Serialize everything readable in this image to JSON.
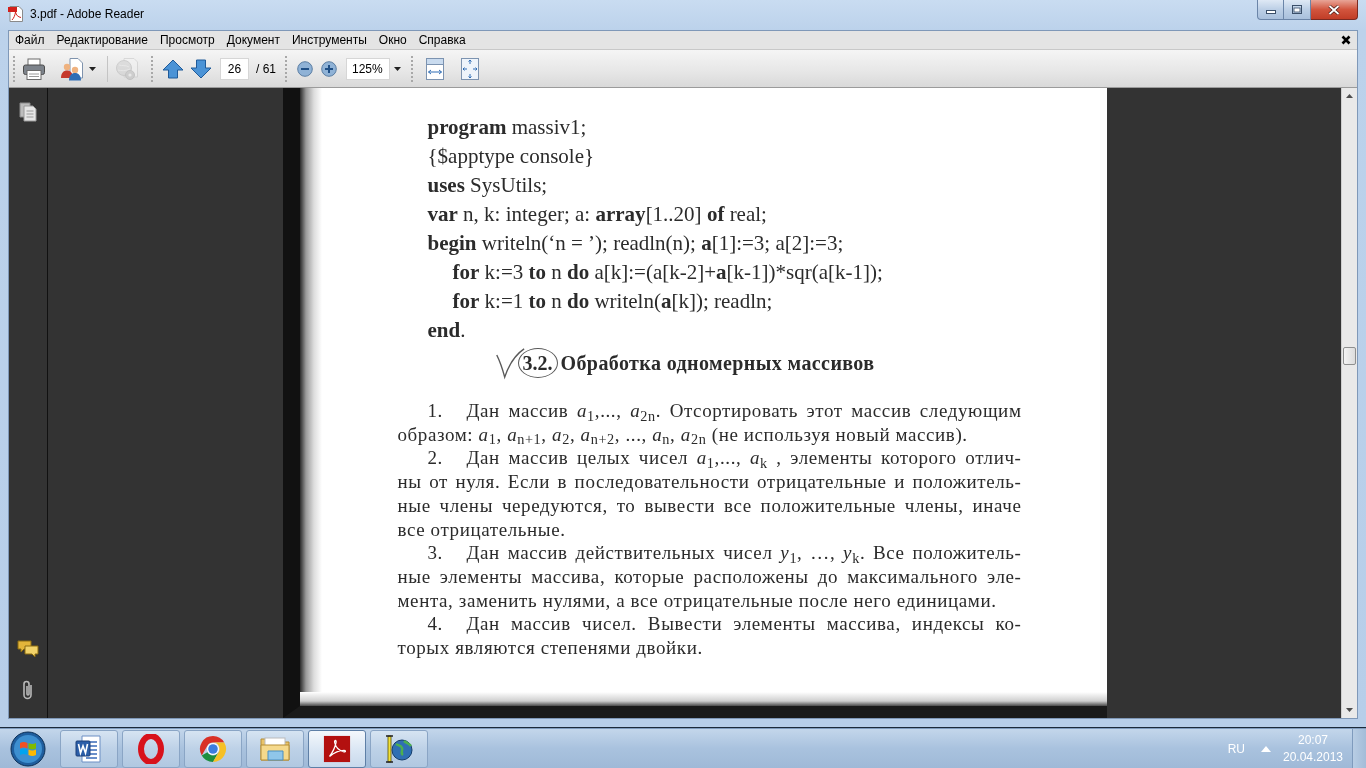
{
  "window": {
    "title": "3.pdf - Adobe Reader"
  },
  "menu": [
    "Файл",
    "Редактирование",
    "Просмотр",
    "Документ",
    "Инструменты",
    "Окно",
    "Справка"
  ],
  "toolbar": {
    "file_tools": [
      {
        "kind": "print",
        "disabled": false
      },
      {
        "kind": "create",
        "disabled": false
      },
      {
        "kind": "share",
        "disabled": true
      }
    ],
    "page_field": {
      "value": "26"
    },
    "page_count": "/ 61",
    "zoom_field": {
      "value": "125%"
    }
  },
  "document": {
    "code_lines": [
      {
        "text": "**program** massiv1;"
      },
      {
        "text": "{$apptype console}"
      },
      {
        "text": "**uses** SysUtils;"
      },
      {
        "text": "**var** n, k: integer; a: **array**[1..20] **of** real;"
      },
      {
        "text": "**begin** writeln(‘n = ’); readln(n); **a**[1]:=3; a[2]:=3;",
        "children": [
          {
            "text": "**for** k:=3 **to** n **do** a[k]:=(a[k-2]+**a**[k-1])*sqr(a[k-1]);"
          },
          {
            "text": "**for** k:=1 **to** n **do** writeln(**a**[k]); readln;"
          }
        ]
      },
      {
        "text": "**end**."
      }
    ],
    "section": {
      "number": "3.2.",
      "title": "Обработка одномерных массивов"
    },
    "exercises": [
      {
        "number": "1.",
        "lines": [
          "Дан массив *a*$_{1}$,..., *a*$_{2n}$. Отсортировать этот массив следующим",
          "образом: *a*$_{1}$, *a*$_{n+1}$, *a*$_{2}$, *a*$_{n+2}$, ..., *a*$_{n}$, *a*$_{2n}$ (не используя новый массив)."
        ]
      },
      {
        "number": "2.",
        "lines": [
          "Дан массив целых чисел *a*$_{1}$,..., *a*$_{k}$ , элементы которого отлич-",
          "ны от нуля. Если в последовательности отрицательные и положитель-",
          "ные члены чередуются, то вывести все положительные члены, иначе",
          "все отрицательные."
        ]
      },
      {
        "number": "3.",
        "lines": [
          "Дан массив действительных чисел *y*$_{1}$, …, *y*$_{k}$. Все положитель-",
          "ные элементы массива, которые расположены до максимального эле-",
          "мента, заменить нулями, а все отрицательные после него единицами."
        ]
      },
      {
        "number": "4.",
        "lines": [
          "Дан массив чисел. Вывести элементы массива, индексы ко-",
          "торых являются степенями двойки."
        ]
      }
    ]
  },
  "taskbar": {
    "apps": [
      {
        "kind": "document",
        "selected": false
      },
      {
        "kind": "ring",
        "selected": false
      },
      {
        "kind": "wheel",
        "selected": false
      },
      {
        "kind": "folder",
        "selected": false
      },
      {
        "kind": "pdf",
        "selected": true
      },
      {
        "kind": "globe",
        "selected": false
      }
    ],
    "language": "RU",
    "time": "20:07",
    "date": "20.04.2013"
  }
}
